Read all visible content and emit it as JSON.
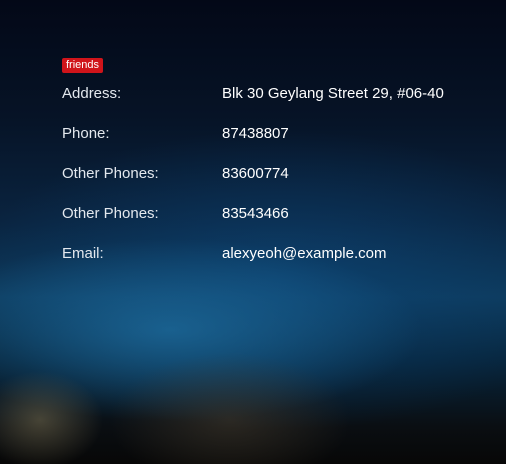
{
  "tags": [
    "friends"
  ],
  "fields": [
    {
      "label": "Address:",
      "value": "Blk 30 Geylang Street 29, #06-40"
    },
    {
      "label": "Phone:",
      "value": "87438807"
    },
    {
      "label": "Other Phones:",
      "value": "83600774"
    },
    {
      "label": "Other Phones:",
      "value": "83543466"
    },
    {
      "label": "Email:",
      "value": "alexyeoh@example.com"
    }
  ],
  "colors": {
    "tag_background": "#d0141a",
    "label_text": "#e3e8ee",
    "value_text": "#ffffff"
  }
}
